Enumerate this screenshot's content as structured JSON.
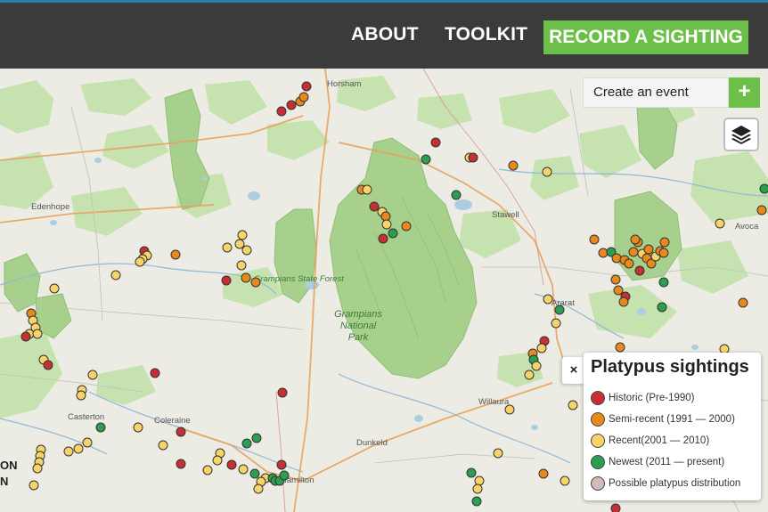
{
  "nav": {
    "about": "ABOUT",
    "toolkit": "TOOLKIT",
    "record": "RECORD A SIGHTING"
  },
  "event": {
    "label": "Create an event",
    "add_symbol": "+"
  },
  "legend": {
    "close_symbol": "×",
    "title": "Platypus sightings",
    "items": [
      {
        "label": "Historic (Pre-1990)",
        "color": "#c62f33"
      },
      {
        "label": "Semi-recent (1991 — 2000)",
        "color": "#e8891d"
      },
      {
        "label": "Recent(2001 — 2010)",
        "color": "#f8d36a"
      },
      {
        "label": "Newest (2011 — present)",
        "color": "#2c9e52"
      },
      {
        "label": "Possible platypus distribution",
        "color": "#cdbdb6"
      }
    ]
  },
  "map": {
    "places": [
      "Horsham",
      "Edenhope",
      "Stawell",
      "Avoca",
      "Grampians State Forest",
      "Grampians National Park",
      "Casterton",
      "Coleraine",
      "Dunkeld",
      "Willaura",
      "Ararat",
      "Hamilton"
    ],
    "edge_label": "ON\nN"
  },
  "colors": {
    "topbar": "#3b3b3b",
    "accent": "#6cc04a",
    "map_land": "#ecece4",
    "forest": "#b9dba0",
    "park": "#a8d08d"
  }
}
